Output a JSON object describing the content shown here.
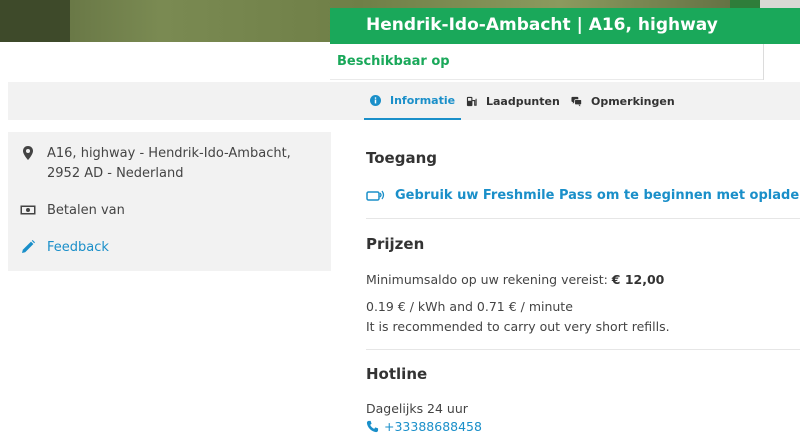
{
  "header": {
    "title": "Hendrik-Ido-Ambacht | A16, highway",
    "availability": "Beschikbaar op"
  },
  "colors": {
    "brand_green": "#1aa85a",
    "link_blue": "#1a8fc9",
    "panel_gray": "#f2f2f2"
  },
  "tabs": [
    {
      "label": "Informatie",
      "icon": "info-icon",
      "active": true
    },
    {
      "label": "Laadpunten",
      "icon": "charging-station-icon",
      "active": false
    },
    {
      "label": "Opmerkingen",
      "icon": "comments-icon",
      "active": false
    }
  ],
  "sidebar": {
    "address": "A16, highway - Hendrik-Ido-Ambacht, 2952 AD - Nederland",
    "payment": "Betalen van",
    "feedback": "Feedback"
  },
  "access": {
    "heading": "Toegang",
    "pass_link": "Gebruik uw Freshmile Pass om te beginnen met opladen"
  },
  "prices": {
    "heading": "Prijzen",
    "minimum_label": "Minimumsaldo op uw rekening vereist:",
    "minimum_amount": "€ 12,00",
    "rate": "0.19 € / kWh and 0.71 € / minute",
    "note": "It is recommended to carry out very short refills."
  },
  "hotline": {
    "heading": "Hotline",
    "hours": "Dagelijks 24 uur",
    "phone": "+33388688458"
  }
}
